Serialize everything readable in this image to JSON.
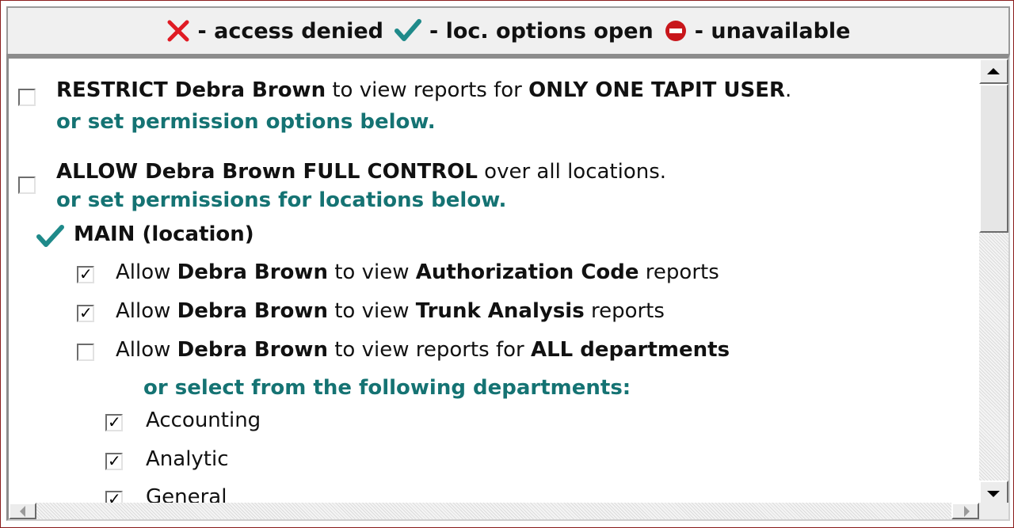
{
  "legend": {
    "denied_text": "- access denied",
    "open_text": "- loc. options open",
    "unavailable_text": "- unavailable",
    "colors": {
      "denied": "#e01b24",
      "open": "#1f8a8a",
      "unavailable": "#c8161b"
    },
    "icons": {
      "denied": "x-icon",
      "open": "checkmark-icon",
      "unavailable": "no-entry-icon"
    }
  },
  "restrict": {
    "checked": false,
    "bold_prefix": "RESTRICT Debra Brown",
    "middle": " to view reports for ",
    "bold_suffix": "ONLY ONE TAPIT USER",
    "end": ".",
    "alt": "or set permission options below."
  },
  "full_control": {
    "checked": false,
    "bold_prefix": "ALLOW Debra Brown FULL CONTROL",
    "middle": " over all locations.",
    "alt": "or set permissions for locations below."
  },
  "location": {
    "name": "MAIN (location)",
    "permissions": [
      {
        "checked": true,
        "pre": "Allow ",
        "user": "Debra Brown",
        "mid": " to view ",
        "target": "Authorization Code",
        "post": " reports"
      },
      {
        "checked": true,
        "pre": "Allow ",
        "user": "Debra Brown",
        "mid": " to view ",
        "target": "Trunk Analysis",
        "post": " reports"
      },
      {
        "checked": false,
        "pre": "Allow ",
        "user": "Debra Brown",
        "mid": " to view reports for ",
        "target": "ALL departments",
        "post": ""
      }
    ],
    "dept_prompt": "or select from the following departments:",
    "departments": [
      {
        "checked": true,
        "name": "Accounting"
      },
      {
        "checked": true,
        "name": "Analytic"
      },
      {
        "checked": true,
        "name": "General"
      }
    ]
  }
}
